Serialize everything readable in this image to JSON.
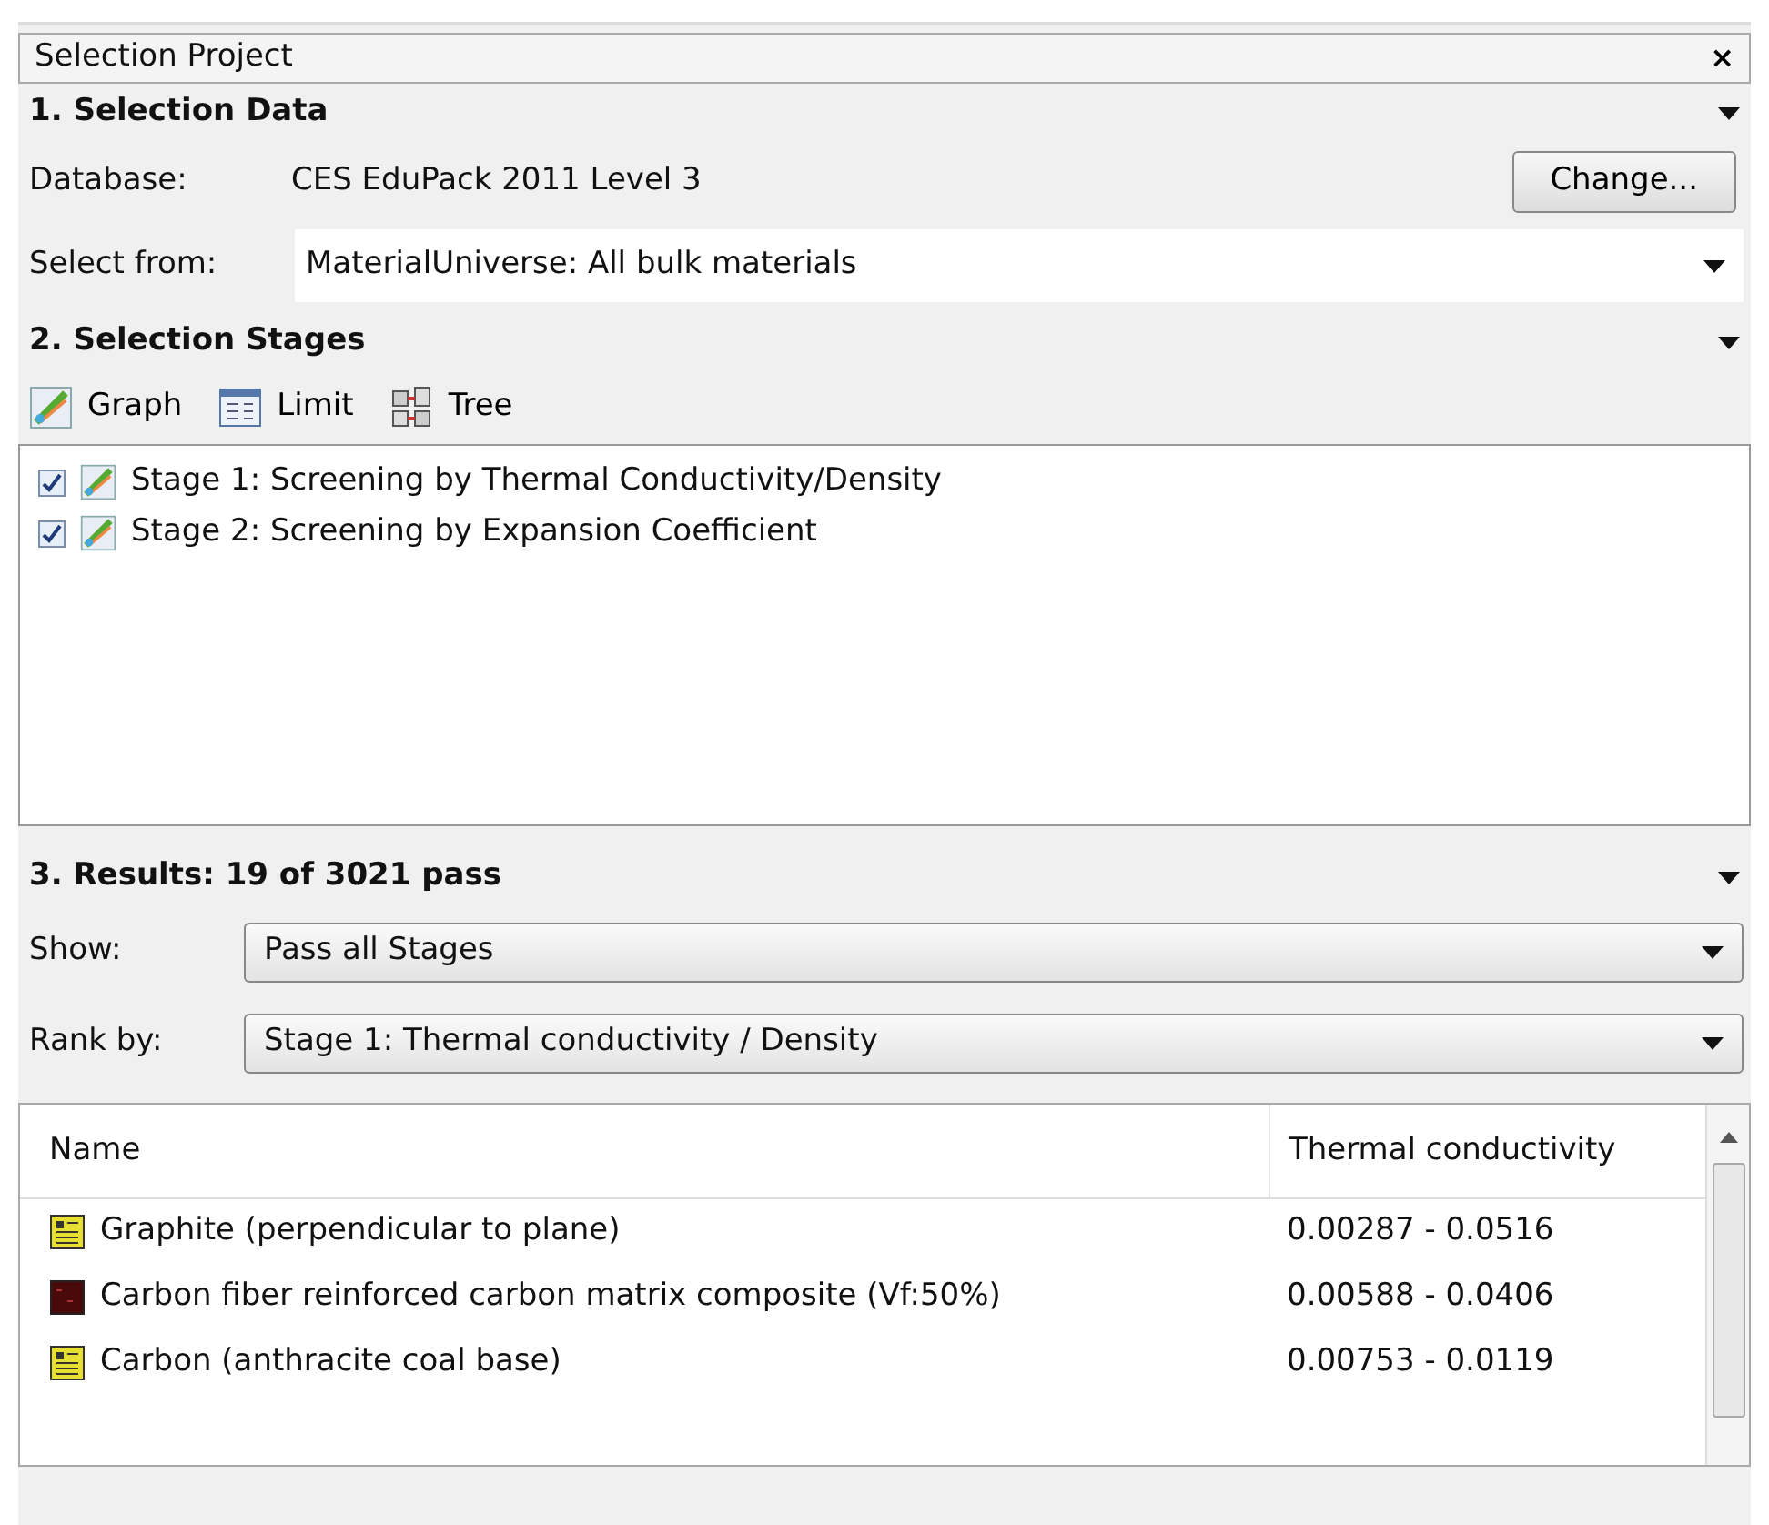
{
  "panel": {
    "title": "Selection Project",
    "close": "×"
  },
  "selection_data": {
    "heading": "1. Selection Data",
    "database_label": "Database:",
    "database_value": "CES EduPack 2011 Level 3",
    "change_button": "Change...",
    "select_from_label": "Select from:",
    "select_from_value": "MaterialUniverse: All bulk materials"
  },
  "selection_stages": {
    "heading": "2. Selection Stages",
    "tools": [
      {
        "kind": "graph",
        "label": "Graph"
      },
      {
        "kind": "limit",
        "label": "Limit"
      },
      {
        "kind": "tree",
        "label": "Tree"
      }
    ],
    "stages": [
      {
        "label": "Stage 1: Screening by Thermal Conductivity/Density",
        "checked": true
      },
      {
        "label": "Stage 2: Screening by Expansion Coefficient",
        "checked": true
      }
    ]
  },
  "results": {
    "heading": "3. Results: 19 of 3021 pass",
    "show_label": "Show:",
    "show_value": "Pass all Stages",
    "rank_label": "Rank by:",
    "rank_value": "Stage 1: Thermal conductivity / Density",
    "table": {
      "columns": [
        "Name",
        "Thermal conductivity"
      ],
      "rows": [
        {
          "kind": "datasheet",
          "name": "Graphite (perpendicular to plane)",
          "value": "0.00287 - 0.0516"
        },
        {
          "kind": "composite",
          "name": "Carbon fiber reinforced carbon matrix composite (Vf:50%)",
          "value": "0.00588 - 0.0406"
        },
        {
          "kind": "datasheet",
          "name": "Carbon (anthracite coal base)",
          "value": "0.00753 - 0.0119"
        }
      ]
    }
  }
}
